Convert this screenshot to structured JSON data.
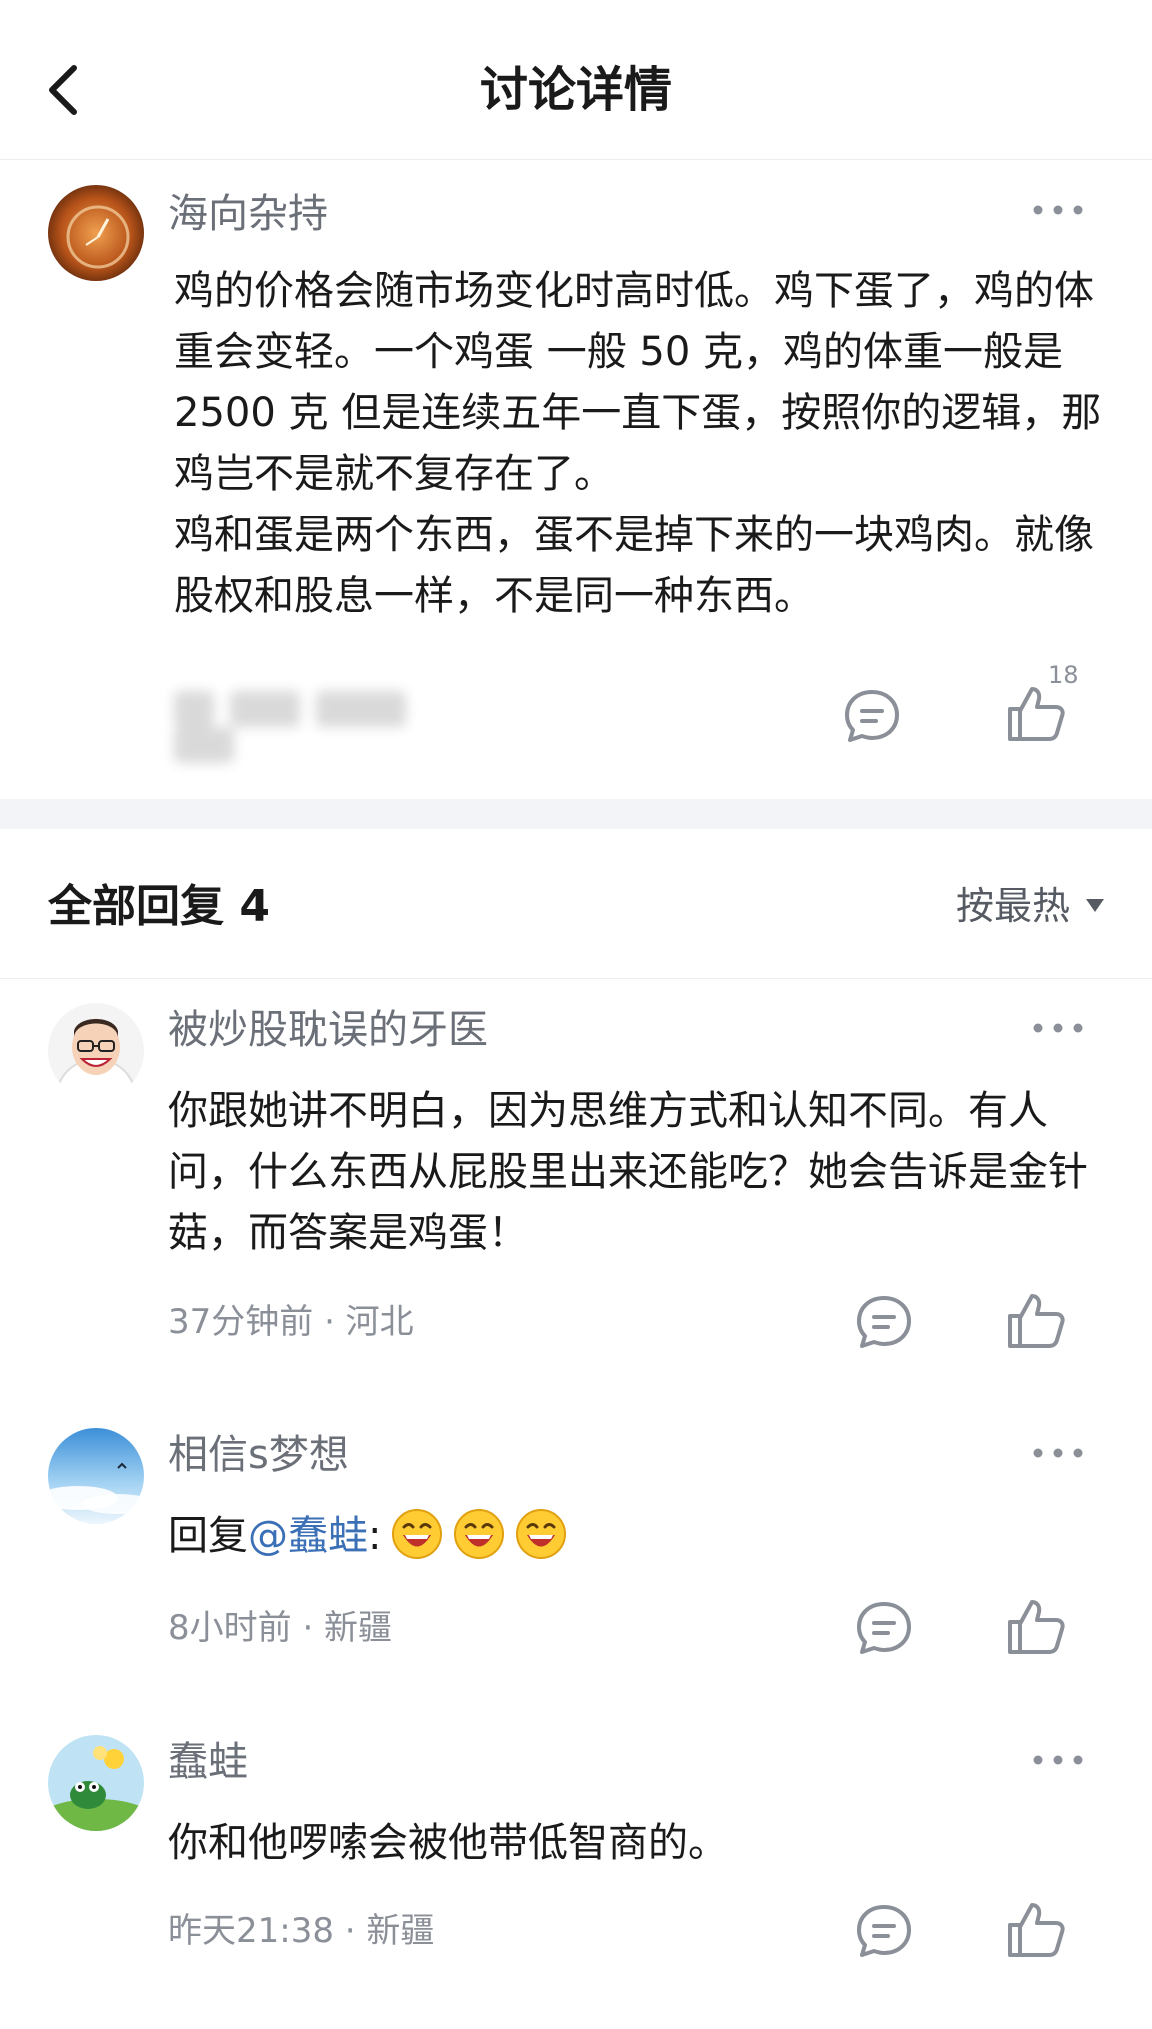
{
  "header": {
    "title": "讨论详情"
  },
  "post": {
    "author": "海向杂持",
    "paragraphs": [
      "鸡的价格会随市场变化时高时低。鸡下蛋了，鸡的体重会变轻。一个鸡蛋 一般 50 克，鸡的体重一般是 2500 克 但是连续五年一直下蛋，按照你的逻辑，那鸡岂不是就不复存在了。",
      "鸡和蛋是两个东西，蛋不是掉下来的一块鸡肉。就像股权和股息一样，不是同一种东西。"
    ],
    "like_count": "18"
  },
  "replies": {
    "title": "全部回复 4",
    "sort_label": "按最热"
  },
  "comments": [
    {
      "author": "被炒股耽误的牙医",
      "text": "你跟她讲不明白，因为思维方式和认知不同。有人问，什么东西从屁股里出来还能吃？她会告诉是金针菇，而答案是鸡蛋！",
      "meta": "37分钟前 · 河北"
    },
    {
      "author": "相信s梦想",
      "reply_prefix": "回复",
      "mention": "@蠢蛙",
      "colon": ":",
      "meta": "8小时前 · 新疆"
    },
    {
      "author": "蠢蛙",
      "text": "你和他啰嗦会被他带低智商的。",
      "meta": "昨天21:38 · 新疆"
    }
  ],
  "icons": {
    "back": "chevron-left-icon",
    "more": "more-dots-icon",
    "comment": "comment-bubble-icon",
    "like": "thumbs-up-icon",
    "emoji": "laughing-emoji-icon"
  },
  "colors": {
    "text_primary": "#1a1a1a",
    "text_secondary": "#6a6f78",
    "meta": "#8a8f98",
    "mention": "#3b6fb6",
    "divider": "#f2f4f7"
  }
}
